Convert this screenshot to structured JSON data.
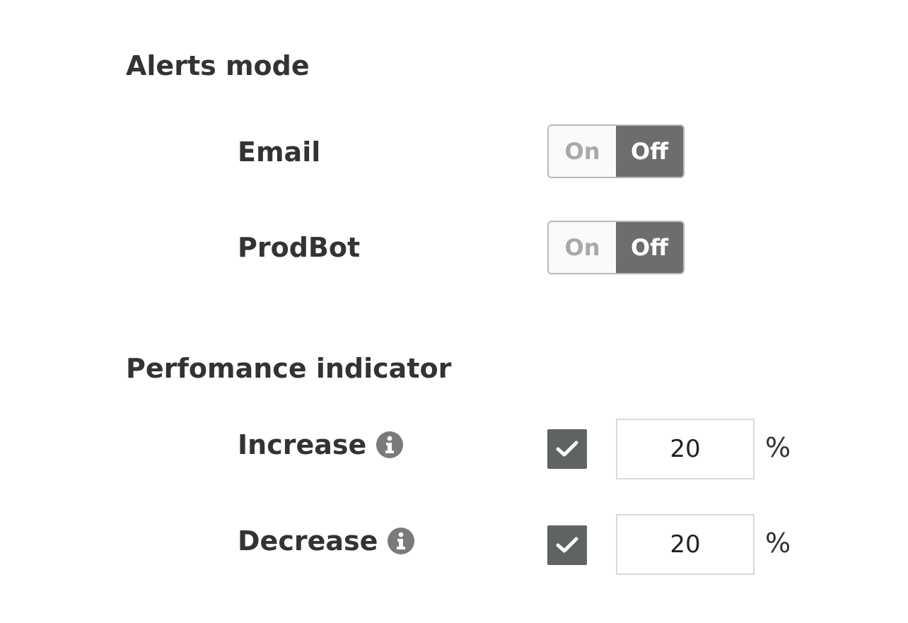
{
  "alerts": {
    "title": "Alerts mode",
    "rows": [
      {
        "label": "Email",
        "on_label": "On",
        "off_label": "Off",
        "selected": "Off"
      },
      {
        "label": "ProdBot",
        "on_label": "On",
        "off_label": "Off",
        "selected": "Off"
      }
    ]
  },
  "performance": {
    "title": "Perfomance indicator",
    "rows": [
      {
        "label": "Increase",
        "icon": "info-icon",
        "checked": true,
        "value": "20",
        "unit": "%"
      },
      {
        "label": "Decrease",
        "icon": "info-icon",
        "checked": true,
        "value": "20",
        "unit": "%"
      }
    ]
  },
  "colors": {
    "text": "#333333",
    "toggle_selected_bg": "#6d6d6d",
    "checkbox_bg": "#5f6362",
    "icon": "#7a7a7a"
  }
}
